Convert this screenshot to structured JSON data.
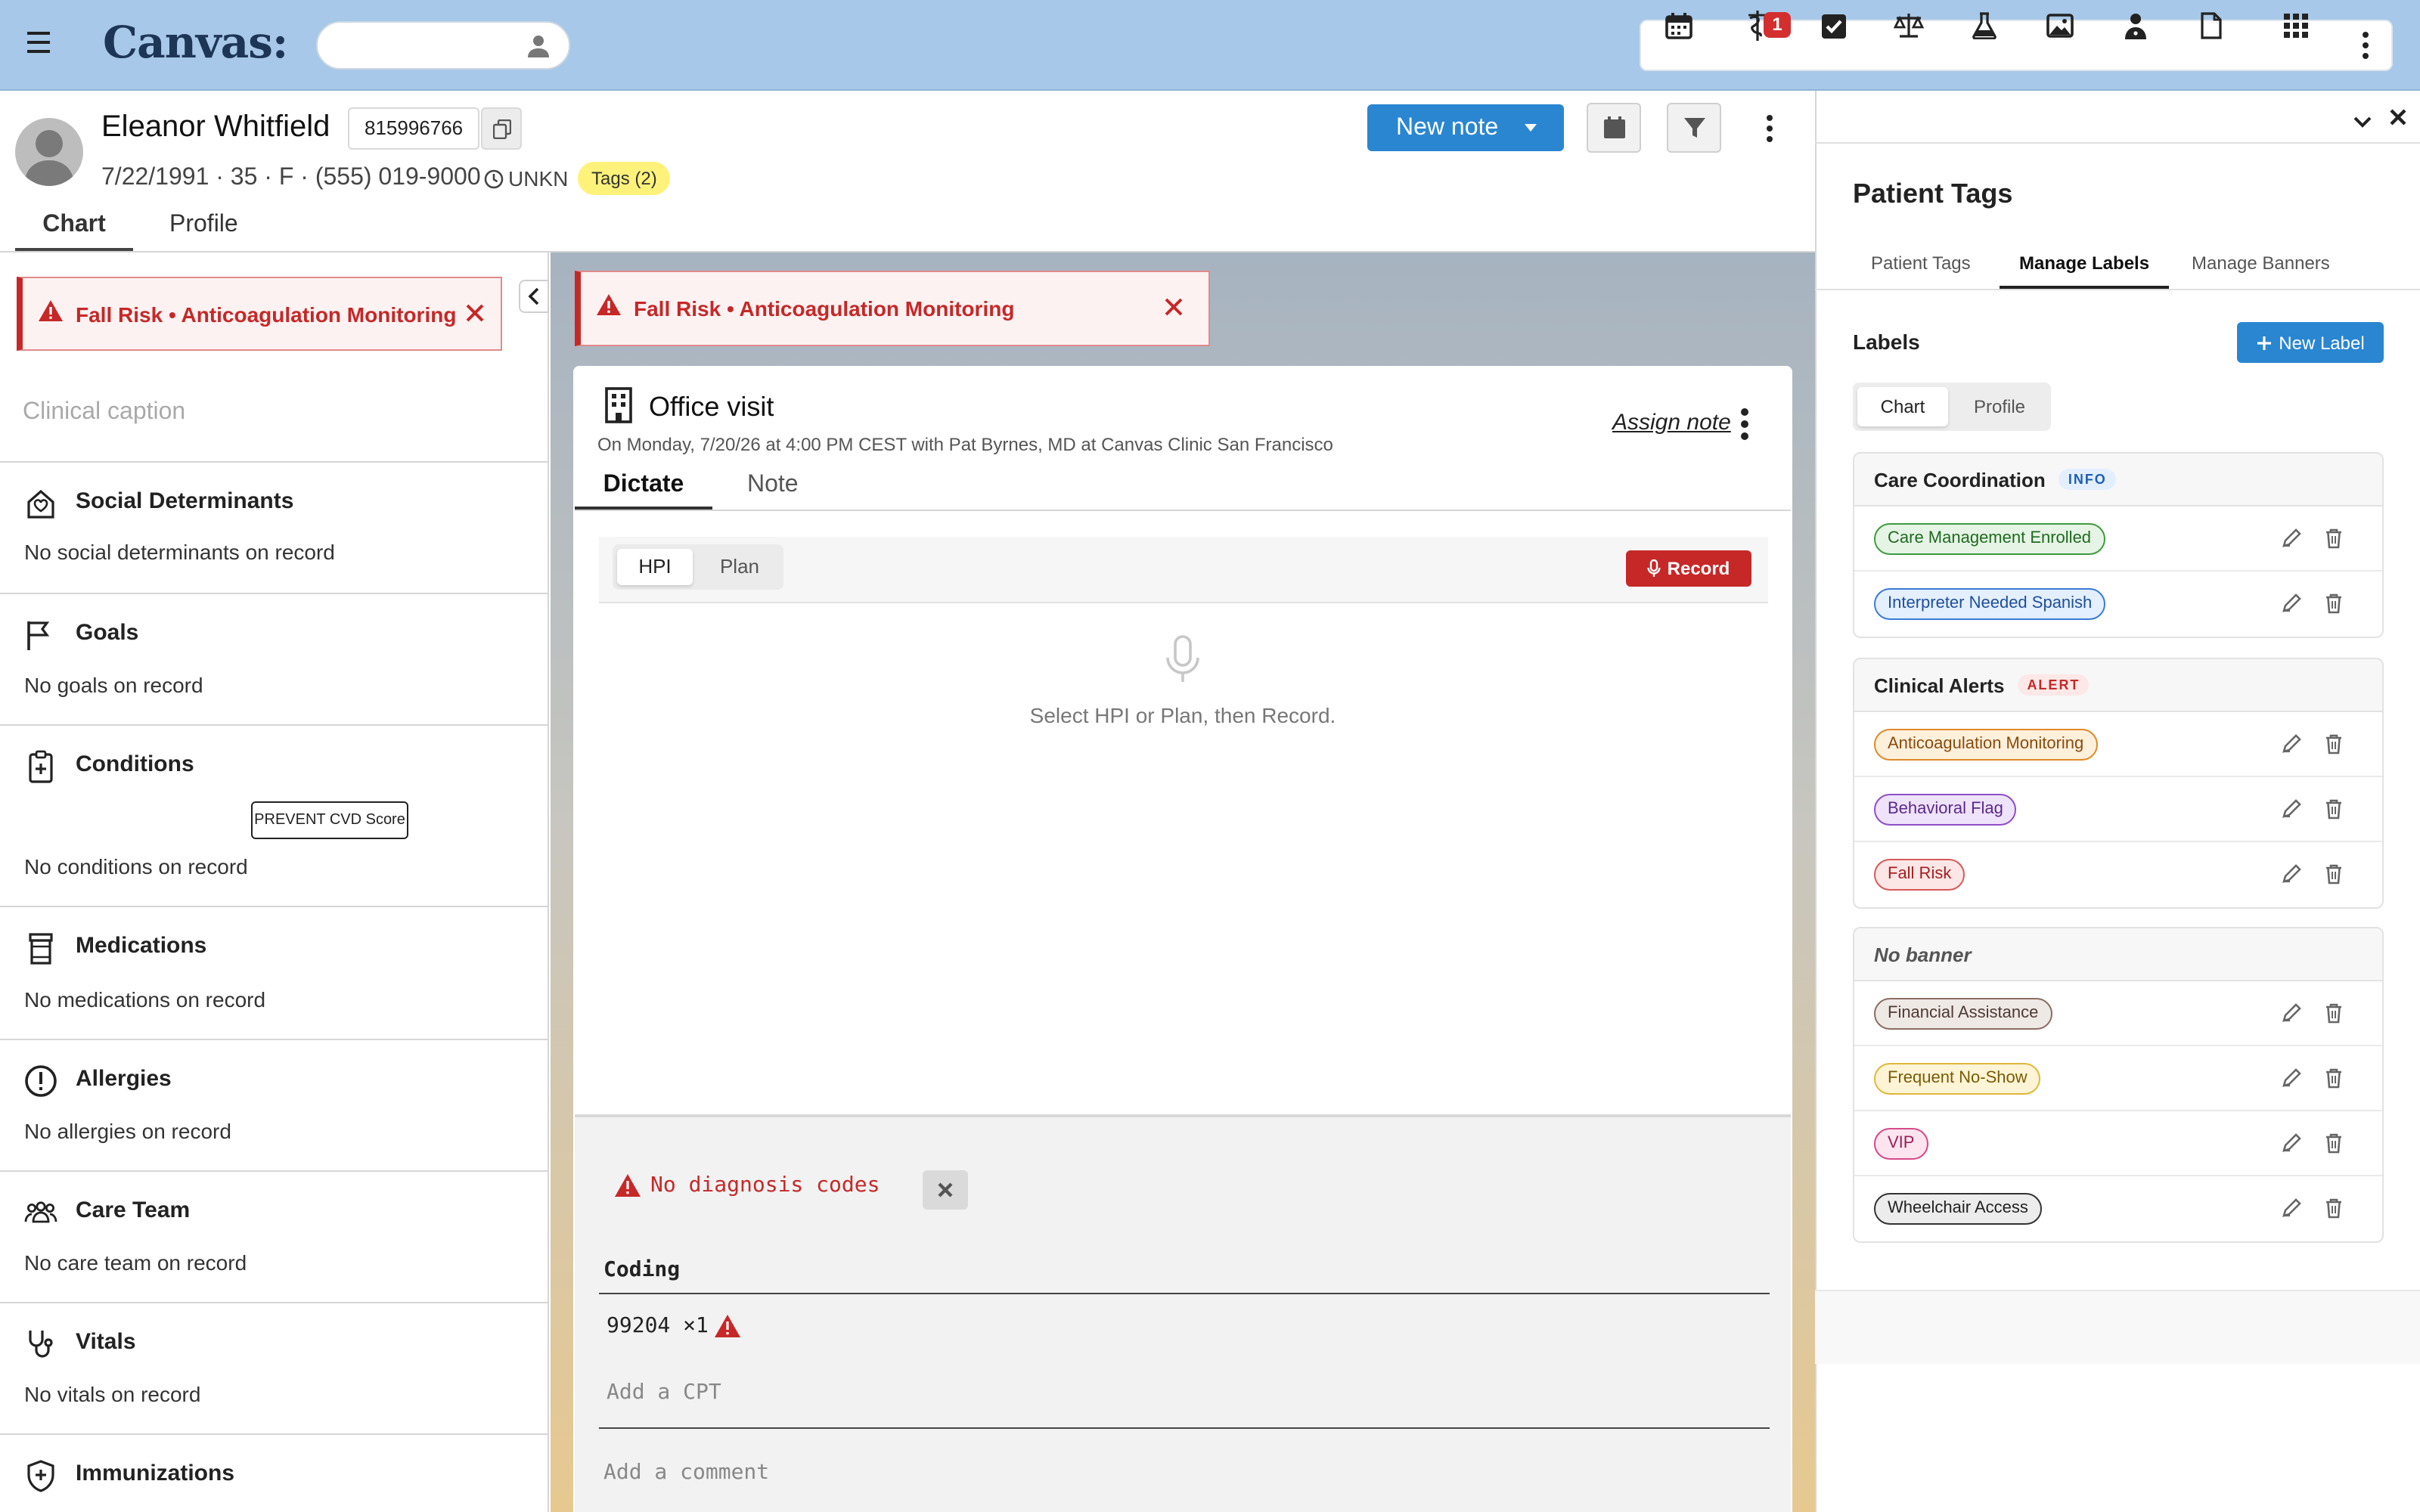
{
  "app": {
    "logo": "Canvas:",
    "notification_count": "1",
    "toolbar_icons": [
      "calendar-icon",
      "caduceus-icon",
      "checkbox-icon",
      "scales-icon",
      "flask-icon",
      "image-icon",
      "doctor-icon",
      "document-icon",
      "grid-icon",
      "more-icon"
    ]
  },
  "search": {
    "placeholder": ""
  },
  "patient": {
    "name": "Eleanor Whitfield",
    "id": "815996766",
    "demographics": "7/22/1991 · 35 · F · (555) 019-9000",
    "timezone": "UNKN",
    "tags_label": "Tags (2)"
  },
  "actions": {
    "new_note": "New note"
  },
  "main_tabs": [
    {
      "label": "Chart",
      "active": true
    },
    {
      "label": "Profile",
      "active": false
    }
  ],
  "banner": {
    "text": "Fall Risk • Anticoagulation Monitoring"
  },
  "sidebar": {
    "caption_placeholder": "Clinical caption",
    "prevent_label": "PREVENT CVD Score",
    "sections": [
      {
        "title": "Social Determinants",
        "empty": "No social determinants on record",
        "icon": "house-icon"
      },
      {
        "title": "Goals",
        "empty": "No goals on record",
        "icon": "flag-icon"
      },
      {
        "title": "Conditions",
        "empty": "No conditions on record",
        "icon": "clipboard-plus-icon"
      },
      {
        "title": "Medications",
        "empty": "No medications on record",
        "icon": "pill-bottle-icon"
      },
      {
        "title": "Allergies",
        "empty": "No allergies on record",
        "icon": "exclamation-circle-icon"
      },
      {
        "title": "Care Team",
        "empty": "No care team on record",
        "icon": "people-icon"
      },
      {
        "title": "Vitals",
        "empty": "No vitals on record",
        "icon": "stethoscope-icon"
      },
      {
        "title": "Immunizations",
        "empty": "",
        "icon": "shield-plus-icon"
      }
    ]
  },
  "note": {
    "title": "Office visit",
    "subtitle": "On Monday, 7/20/26 at 4:00 PM CEST with Pat Byrnes, MD at Canvas Clinic San Francisco",
    "assign_label": "Assign note",
    "tabs": [
      {
        "label": "Dictate",
        "active": true
      },
      {
        "label": "Note",
        "active": false
      }
    ],
    "dictate": {
      "segments": [
        {
          "label": "HPI",
          "active": true
        },
        {
          "label": "Plan",
          "active": false
        }
      ],
      "record_label": "Record",
      "hint": "Select HPI or Plan, then Record."
    },
    "no_diagnosis": "No diagnosis codes",
    "coding_header": "Coding",
    "cpt_code": "99204 ×1",
    "add_cpt_placeholder": "Add a CPT",
    "add_comment_placeholder": "Add a comment"
  },
  "right_panel": {
    "title": "Patient Tags",
    "tabs": [
      {
        "label": "Patient Tags",
        "active": false
      },
      {
        "label": "Manage Labels",
        "active": true
      },
      {
        "label": "Manage Banners",
        "active": false
      }
    ],
    "labels_heading": "Labels",
    "new_label": "New Label",
    "segments": [
      {
        "label": "Chart",
        "active": true
      },
      {
        "label": "Profile",
        "active": false
      }
    ],
    "groups": [
      {
        "name": "Care Coordination",
        "badge": "INFO",
        "badge_colors": {
          "bg": "#e3efff",
          "fg": "#1e5fb3"
        },
        "labels": [
          {
            "text": "Care Management Enrolled",
            "bg": "#e6f4e6",
            "border": "#3f9a3f",
            "fg": "#1f6b1f"
          },
          {
            "text": "Interpreter Needed Spanish",
            "bg": "#e4efff",
            "border": "#3a7bd5",
            "fg": "#1e4f9a"
          }
        ]
      },
      {
        "name": "Clinical Alerts",
        "badge": "ALERT",
        "badge_colors": {
          "bg": "#fde8e8",
          "fg": "#c62828"
        },
        "labels": [
          {
            "text": "Anticoagulation Monitoring",
            "bg": "#fff0dc",
            "border": "#e08a2a",
            "fg": "#8a4b0a"
          },
          {
            "text": "Behavioral Flag",
            "bg": "#efe2fb",
            "border": "#8e4fc8",
            "fg": "#5a2a8a"
          },
          {
            "text": "Fall Risk",
            "bg": "#fde6e6",
            "border": "#d65a5a",
            "fg": "#a32020"
          }
        ]
      },
      {
        "name": "No banner",
        "badge": "",
        "labels": [
          {
            "text": "Financial Assistance",
            "bg": "#efe9e6",
            "border": "#8a6e62",
            "fg": "#4e3a32"
          },
          {
            "text": "Frequent No-Show",
            "bg": "#fff5d6",
            "border": "#e0b83a",
            "fg": "#7a5a05"
          },
          {
            "text": "VIP",
            "bg": "#fde4ef",
            "border": "#d64a8a",
            "fg": "#9a1f58"
          },
          {
            "text": "Wheelchair Access",
            "bg": "#ececec",
            "border": "#333333",
            "fg": "#222222"
          }
        ]
      }
    ]
  },
  "colors": {
    "accent": "#2a86d1",
    "danger": "#c62828",
    "topbar": "#a7c8e8"
  }
}
